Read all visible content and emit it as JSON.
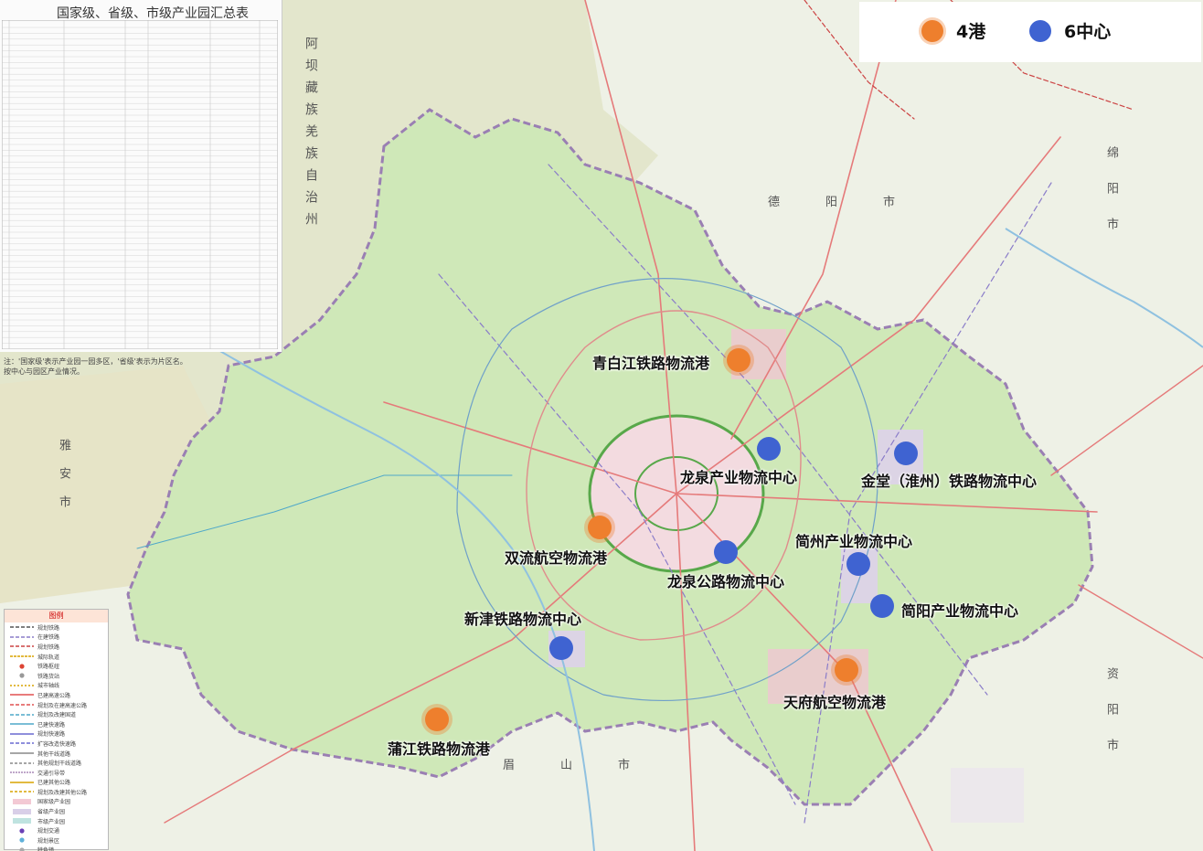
{
  "legend_top": {
    "ports": {
      "label": "4港",
      "color": "#ee7f2d"
    },
    "centers": {
      "label": "6中心",
      "color": "#3f63d1"
    }
  },
  "table": {
    "title": "国家级、省级、市级产业园汇总表",
    "note": "注：'国家级'表示产业园一园多区，'省级'表示为片区名。\n按中心与园区产业情况。"
  },
  "ports": [
    {
      "name": "青白江铁路物流港"
    },
    {
      "name": "双流航空物流港"
    },
    {
      "name": "天府航空物流港"
    },
    {
      "name": "蒲江铁路物流港"
    }
  ],
  "centers": [
    {
      "name": "龙泉产业物流中心"
    },
    {
      "name": "金堂（淮州）铁路物流中心"
    },
    {
      "name": "简州产业物流中心"
    },
    {
      "name": "龙泉公路物流中心"
    },
    {
      "name": "简阳产业物流中心"
    },
    {
      "name": "新津铁路物流中心"
    }
  ],
  "regions": [
    {
      "name": "阿坝藏族羌族自治州"
    },
    {
      "name": "德阳市"
    },
    {
      "name": "绵阳市"
    },
    {
      "name": "雅安市"
    },
    {
      "name": "眉山市"
    },
    {
      "name": "资阳市"
    }
  ],
  "map_legend": {
    "title": "图例",
    "items": [
      "规划铁路",
      "在建铁路",
      "规划铁路",
      "城际轨道",
      "铁路枢纽",
      "铁路货站",
      "城市轴线",
      "已建高速公路",
      "规划及在建高速公路",
      "规划及改建国道",
      "已建快速路",
      "规划快速路",
      "扩容改造快速路",
      "其他干线道路",
      "其他规划干线道路",
      "交通引导带",
      "已建其他公路",
      "规划及改建其他公路",
      "国家级产业园",
      "省级产业园",
      "市级产业园",
      "规划交通",
      "规划景区",
      "特色镇"
    ]
  },
  "colors": {
    "land_green": "#cfe8b8",
    "mountain": "#e6e8d2",
    "urban": "#f0d6dc",
    "industry": "#d9cfe8"
  }
}
